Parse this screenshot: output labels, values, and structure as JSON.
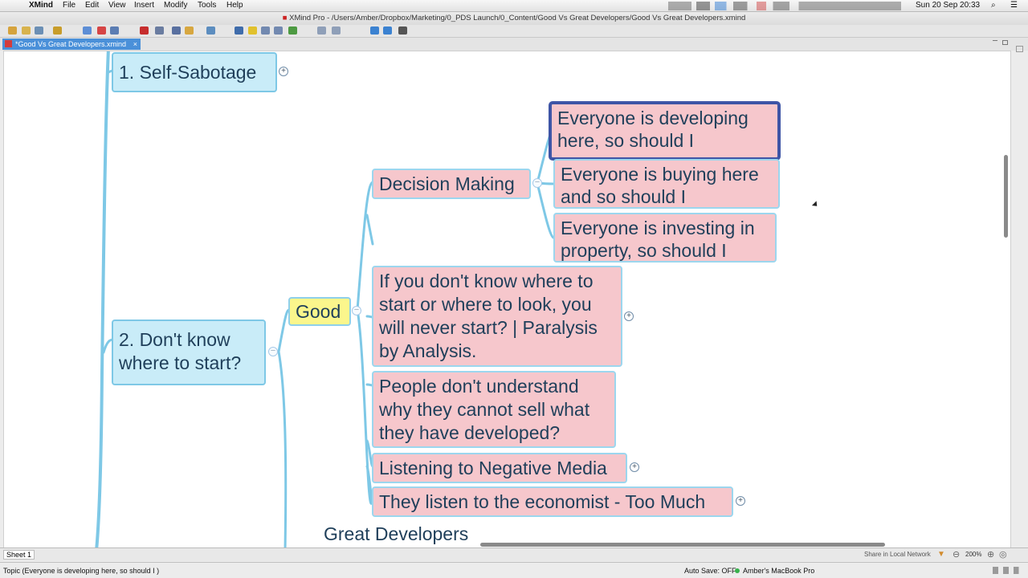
{
  "menubar": {
    "apple": "",
    "app": "XMind",
    "items": [
      "File",
      "Edit",
      "View",
      "Insert",
      "Modify",
      "Tools",
      "Help"
    ],
    "clock": "Sun 20 Sep  20:33"
  },
  "window": {
    "title": "XMind Pro - /Users/Amber/Dropbox/Marketing/0_PDS Launch/0_Content/Good Vs Great Developers/Good Vs Great Developers.xmind"
  },
  "tab": {
    "label": "*Good Vs Great Developers.xmind",
    "close": "×"
  },
  "map": {
    "self_sabotage": "1. Self-Sabotage",
    "dont_know": "2. Don't know where to start?",
    "good": "Good",
    "decision_making": "Decision Making",
    "everyone_developing": "Everyone is developing here, so should I",
    "everyone_buying": "Everyone is buying here and so should I",
    "everyone_investing": "Everyone is investing in property, so should I",
    "paralysis": "If you don't know where to start or where to look, you will never start? | Paralysis by Analysis.",
    "understand": "People don't understand why they cannot sell what they have developed?",
    "negative_media": "Listening to Negative Media",
    "economist": "They listen to the economist - Too Much",
    "great_developers": "Great Developers"
  },
  "bottom": {
    "sheet": "Sheet 1",
    "share": "Share in Local Network",
    "zoom": "200%"
  },
  "status": {
    "topic": "Topic (Everyone is developing here, so should I )",
    "autosave": "Auto Save: OFF",
    "computer": "Amber's MacBook Pro"
  },
  "colors": {
    "topic_blue": "#c9ecf8",
    "subtopic_pink": "#f6c7cc",
    "good_yellow": "#fbf68c",
    "selection_border": "#3e55a6",
    "connector": "#7ec8e6",
    "tab_active": "#4a90d9"
  }
}
